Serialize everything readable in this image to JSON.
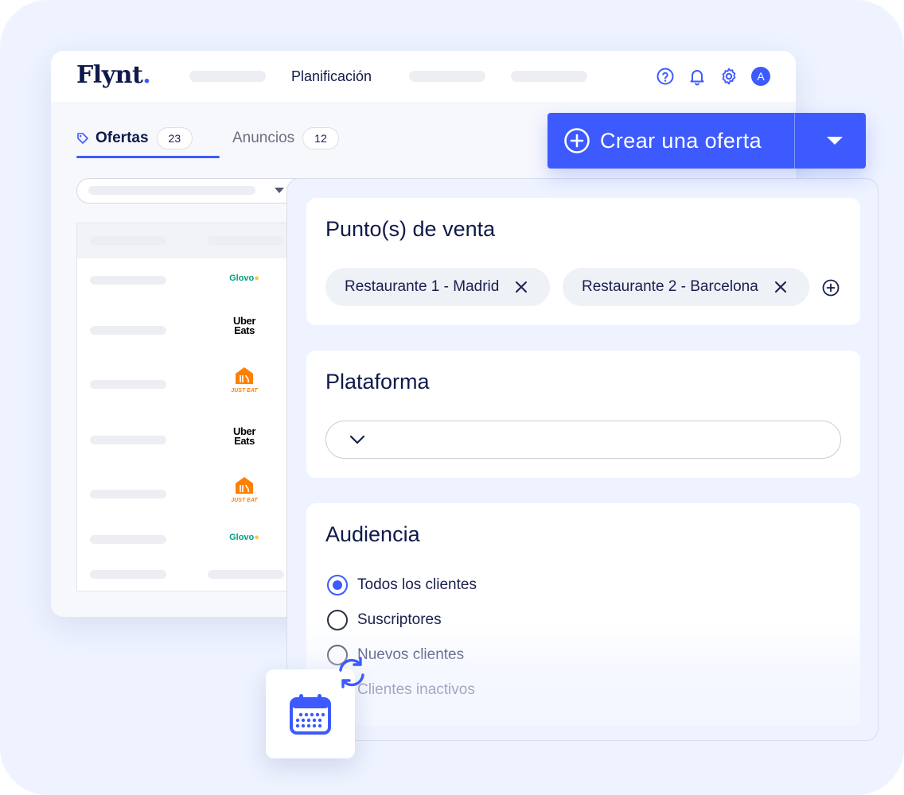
{
  "app": {
    "logo_text": "Flynt",
    "logo_dot": ".",
    "nav_title": "Planificación",
    "avatar_initial": "A",
    "icons": [
      "help-icon",
      "bell-icon",
      "gear-icon"
    ],
    "accent_color": "#3d5afe"
  },
  "tabs": [
    {
      "label": "Ofertas",
      "count": "23",
      "active": true
    },
    {
      "label": "Anuncios",
      "count": "12",
      "active": false
    }
  ],
  "table": {
    "platforms": [
      "Glovo",
      "Uber Eats",
      "Just Eat",
      "Uber Eats",
      "Just Eat",
      "Glovo"
    ],
    "brand_text": {
      "glovo": "Glovo",
      "glovo_pin": "●",
      "uber_line1": "Uber",
      "uber_line2": "Eats",
      "justeat": "JUST EAT"
    }
  },
  "cta": {
    "label": "Crear una oferta"
  },
  "form": {
    "sales_points": {
      "title": "Punto(s) de venta",
      "chips": [
        "Restaurante 1 - Madrid",
        "Restaurante 2 - Barcelona"
      ]
    },
    "platform": {
      "title": "Plataforma",
      "value": ""
    },
    "audience": {
      "title": "Audiencia",
      "options": [
        "Todos los clientes",
        "Suscriptores",
        "Nuevos clientes",
        "Clientes inactivos"
      ],
      "selected": "Todos los clientes"
    }
  }
}
